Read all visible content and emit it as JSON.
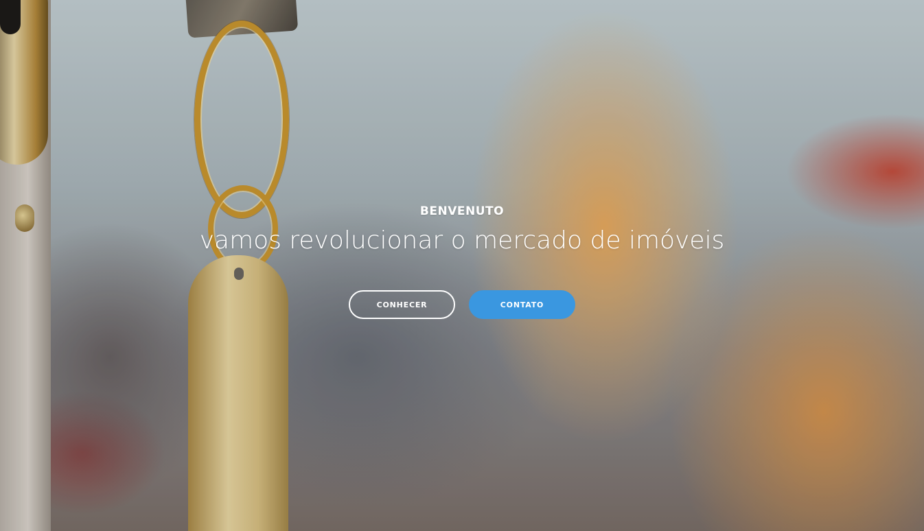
{
  "hero": {
    "eyebrow": "BENVENUTO",
    "headline": "vamos revolucionar o mercado de imóveis",
    "buttons": {
      "primary_outline_label": "CONHECER",
      "contact_label": "CONTATO"
    }
  },
  "colors": {
    "contact_button": "#3a97e0",
    "text": "#ffffff"
  }
}
